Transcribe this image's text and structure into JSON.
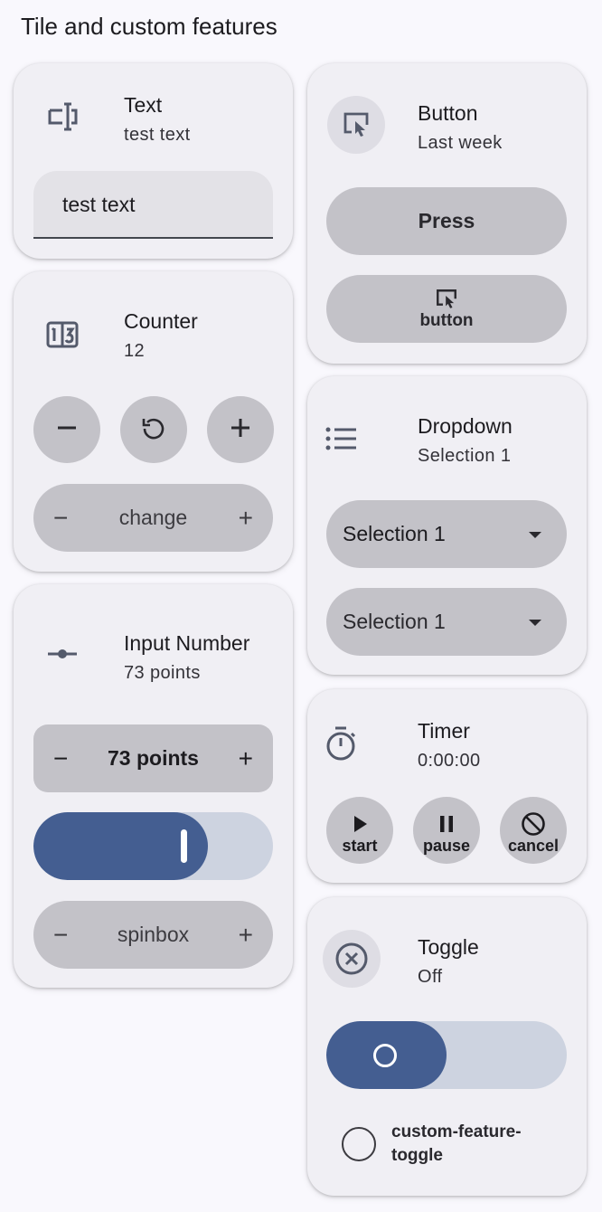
{
  "page": {
    "heading": "Tile and custom features"
  },
  "text_tile": {
    "title": "Text",
    "subtitle": "test text",
    "icon": "text-field-icon",
    "field_value": "test text"
  },
  "counter_tile": {
    "title": "Counter",
    "subtitle": "12",
    "icon": "counter-icon",
    "decrement_icon": "minus-icon",
    "reset_icon": "reset-icon",
    "increment_icon": "plus-icon",
    "stepper": {
      "minus": "−",
      "label": "change",
      "plus": "+"
    }
  },
  "input_number_tile": {
    "title": "Input Number",
    "subtitle": "73 points",
    "icon": "slider-icon",
    "stepper_primary": {
      "minus": "−",
      "label": "73 points",
      "plus": "+"
    },
    "slider": {
      "value": 73,
      "min": 0,
      "max": 100
    },
    "stepper_secondary": {
      "minus": "−",
      "label": "spinbox",
      "plus": "+"
    }
  },
  "button_tile": {
    "title": "Button",
    "subtitle": "Last week",
    "icon": "touch-icon",
    "press_label": "Press",
    "icon_button_label": "button"
  },
  "dropdown_tile": {
    "title": "Dropdown",
    "subtitle": "Selection 1",
    "icon": "list-icon",
    "select_primary": "Selection 1",
    "select_secondary": "Selection 1"
  },
  "timer_tile": {
    "title": "Timer",
    "subtitle": "0:00:00",
    "icon": "timer-icon",
    "start_label": "start",
    "pause_label": "pause",
    "cancel_label": "cancel"
  },
  "toggle_tile": {
    "title": "Toggle",
    "subtitle": "Off",
    "icon": "close-circle-icon",
    "switch_on": false,
    "custom_feature_label": "custom-feature-toggle"
  },
  "colors": {
    "accent": "#445e91",
    "track": "#cdd3e0",
    "card": "#f0eff4",
    "button": "#c3c2c8"
  }
}
